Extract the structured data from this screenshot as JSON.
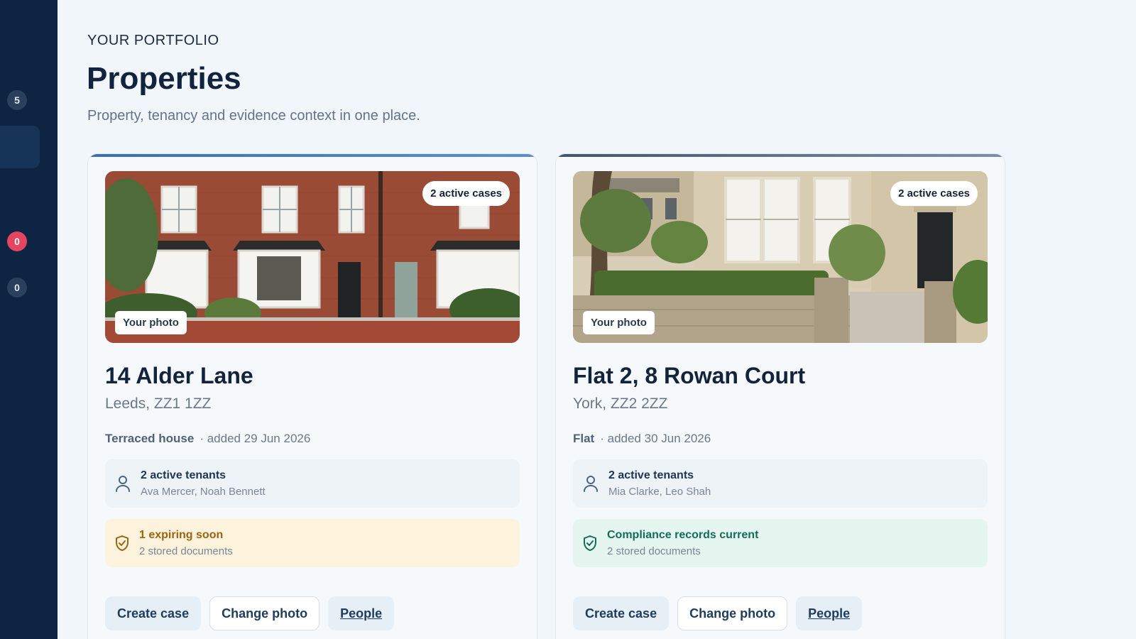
{
  "sidebar": {
    "badges": [
      {
        "count": "5",
        "variant": "neutral"
      },
      {
        "count": "0",
        "variant": "alert"
      },
      {
        "count": "0",
        "variant": "neutral"
      }
    ]
  },
  "header": {
    "eyebrow": "YOUR PORTFOLIO",
    "title": "Properties",
    "subtitle": "Property, tenancy and evidence context in one place."
  },
  "properties": [
    {
      "name": "14 Alder Lane",
      "city": "Leeds, ZZ1 1ZZ",
      "type": "Terraced house",
      "added": "· added 29 Jun 2026",
      "cases_badge": "2 active cases",
      "photo_tag": "Your photo",
      "accent_color": "#4a7fbf",
      "tenants": {
        "title": "2 active tenants",
        "names": "Ava Mercer, Noah Bennett",
        "icon": "user-icon"
      },
      "compliance": {
        "title": "1 expiring soon",
        "docs": "2 stored documents",
        "status": "warning",
        "icon": "shield-check-icon"
      },
      "actions": {
        "create": "Create case",
        "change": "Change photo",
        "people": "People"
      }
    },
    {
      "name": "Flat 2, 8 Rowan Court",
      "city": "York, ZZ2 2ZZ",
      "type": "Flat",
      "added": "· added 30 Jun 2026",
      "cases_badge": "2 active cases",
      "photo_tag": "Your photo",
      "accent_color": "#5b6d84",
      "tenants": {
        "title": "2 active tenants",
        "names": "Mia Clarke, Leo Shah",
        "icon": "user-icon"
      },
      "compliance": {
        "title": "Compliance records current",
        "docs": "2 stored documents",
        "status": "ok",
        "icon": "shield-check-icon"
      },
      "actions": {
        "create": "Create case",
        "change": "Change photo",
        "people": "People"
      }
    }
  ]
}
